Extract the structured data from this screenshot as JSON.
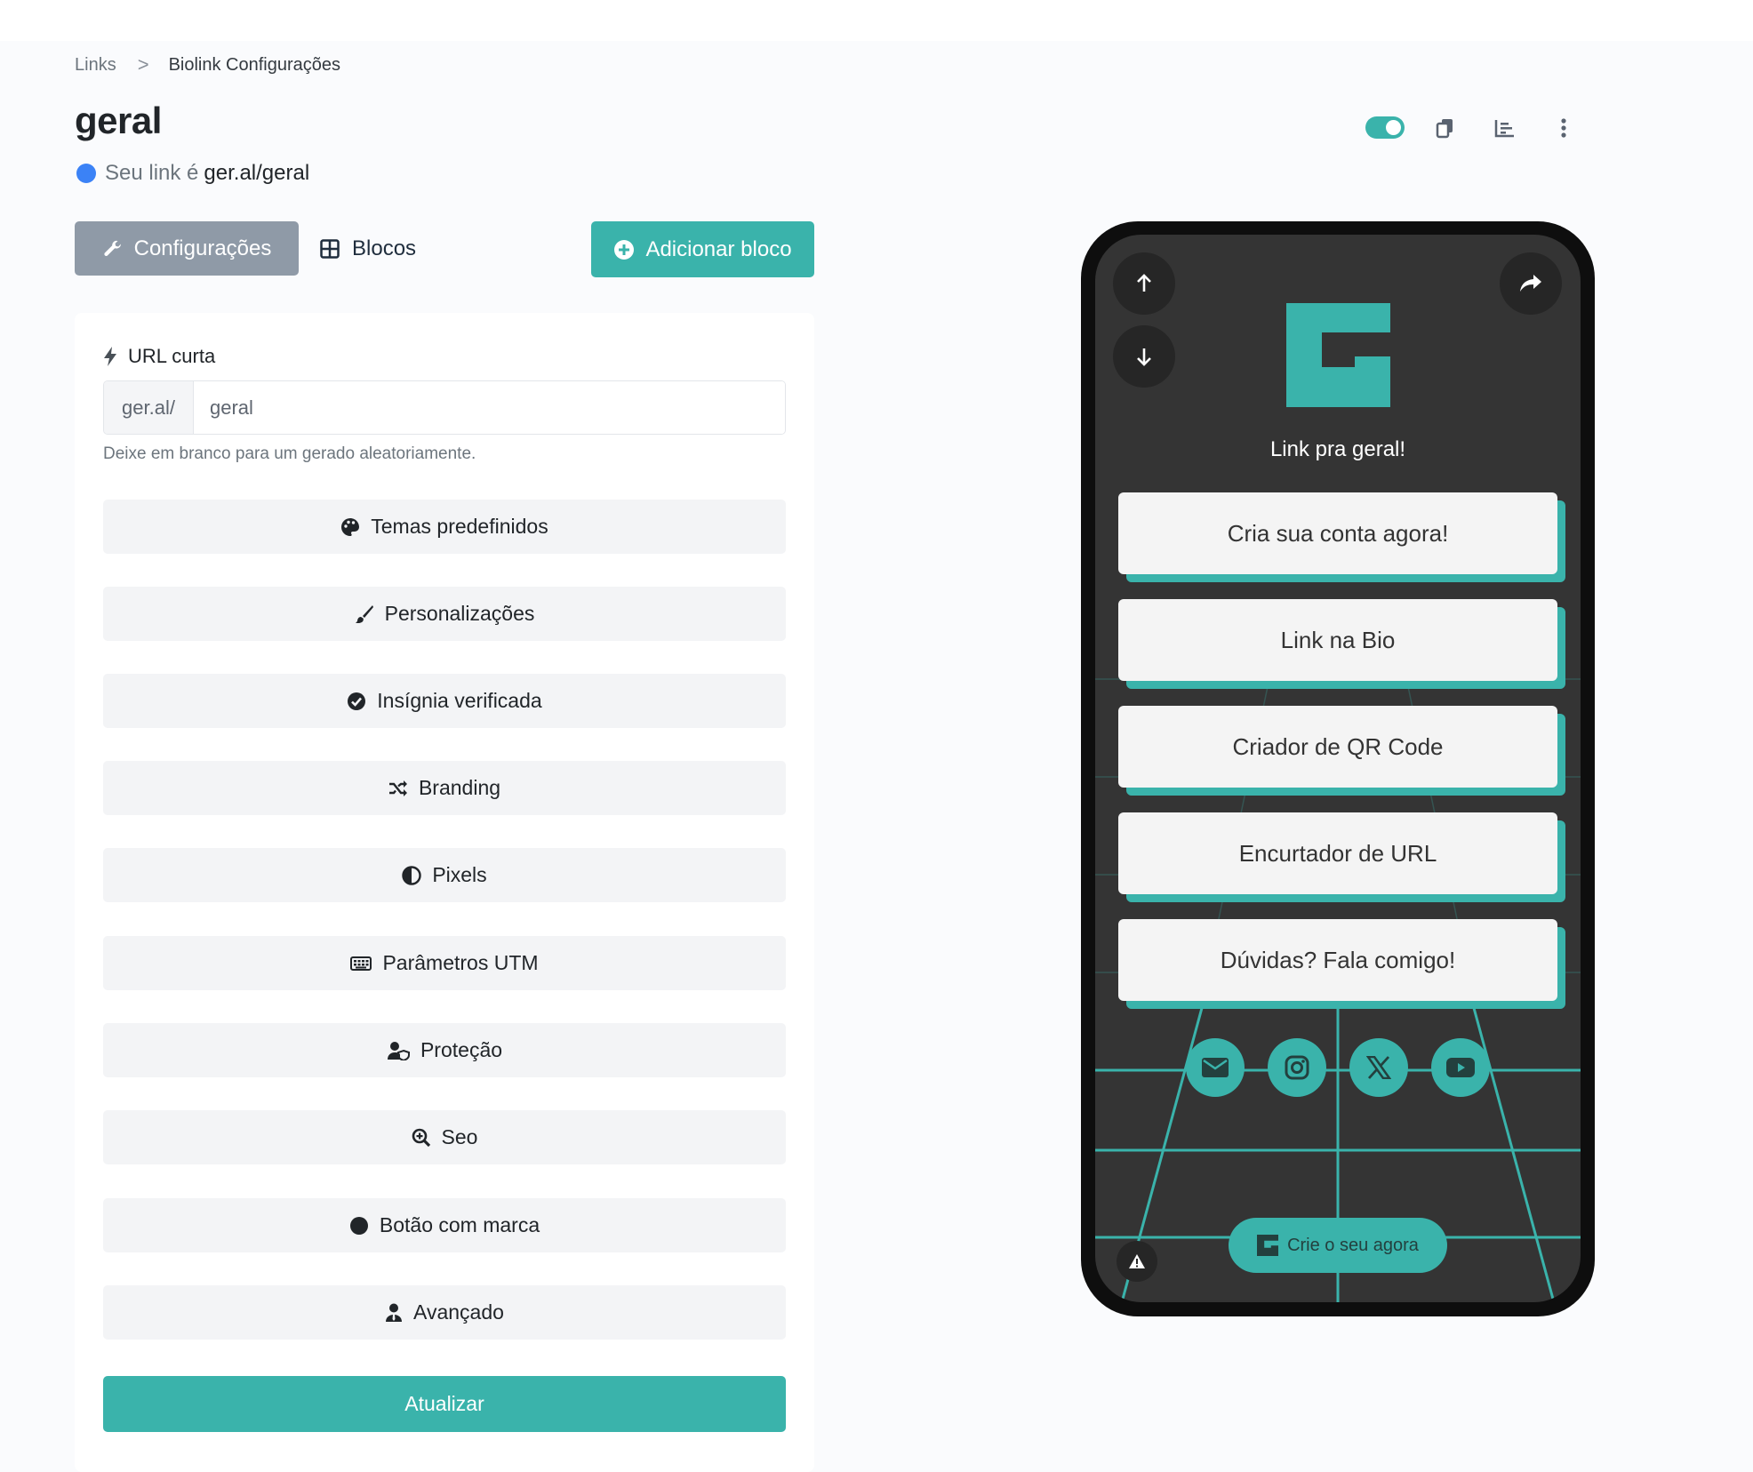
{
  "breadcrumb": {
    "link": "Links",
    "separator": ">",
    "current": "Biolink Configurações"
  },
  "header": {
    "title": "geral",
    "link_prefix": "Seu link é",
    "link_value": "ger.al/geral",
    "status_dot_color": "#3b82f6",
    "toggle_on": true,
    "icons": [
      "toggle-icon",
      "copy-icon",
      "statistics-icon",
      "more-vertical-icon"
    ]
  },
  "tabs": {
    "config_label": "Configurações",
    "blocos_label": "Blocos",
    "add_block_label": "Adicionar bloco"
  },
  "form": {
    "url_label": "URL curta",
    "url_prefix": "ger.al/",
    "url_value": "geral",
    "url_help": "Deixe em branco para um gerado aleatoriamente.",
    "sections": [
      {
        "label": "Temas predefinidos",
        "icon": "palette-icon"
      },
      {
        "label": "Personalizações",
        "icon": "paintbrush-icon"
      },
      {
        "label": "Insígnia verificada",
        "icon": "check-circle-icon"
      },
      {
        "label": "Branding",
        "icon": "random-icon"
      },
      {
        "label": "Pixels",
        "icon": "adjust-icon"
      },
      {
        "label": "Parâmetros UTM",
        "icon": "keyboard-icon"
      },
      {
        "label": "Proteção",
        "icon": "user-shield-icon"
      },
      {
        "label": "Seo",
        "icon": "search-plus-icon"
      },
      {
        "label": "Botão com marca",
        "icon": "circle-icon"
      },
      {
        "label": "Avançado",
        "icon": "user-tie-icon"
      }
    ],
    "submit_label": "Atualizar"
  },
  "preview": {
    "title": "Link pra geral!",
    "links": [
      "Cria sua conta agora!",
      "Link na Bio",
      "Criador de QR Code",
      "Encurtador de URL",
      "Dúvidas? Fala comigo!"
    ],
    "socials": [
      "email-icon",
      "instagram-icon",
      "x-icon",
      "youtube-icon"
    ],
    "cta_label": "Crie o seu agora"
  },
  "colors": {
    "accent": "#3ab3ab",
    "phone_bg": "#343434",
    "tab_active": "#8f9aa7"
  }
}
